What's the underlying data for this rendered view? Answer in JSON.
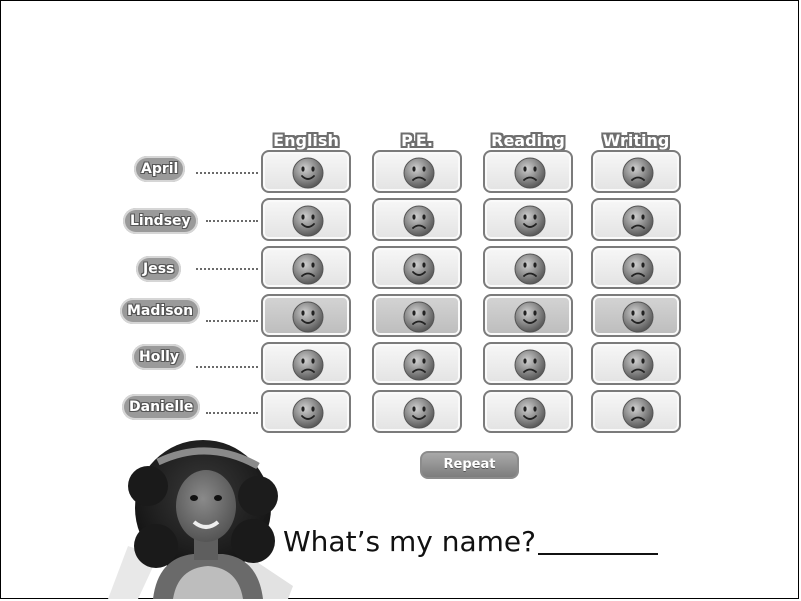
{
  "columns": [
    "English",
    "P.E.",
    "Reading",
    "Writing"
  ],
  "rows": [
    {
      "name": "April",
      "faces": [
        "happy",
        "sad",
        "sad",
        "sad"
      ]
    },
    {
      "name": "Lindsey",
      "faces": [
        "happy",
        "sad",
        "happy",
        "sad"
      ]
    },
    {
      "name": "Jess",
      "faces": [
        "sad",
        "happy",
        "sad",
        "sad"
      ]
    },
    {
      "name": "Madison",
      "faces": [
        "happy",
        "sad",
        "happy",
        "happy"
      ]
    },
    {
      "name": "Holly",
      "faces": [
        "sad",
        "sad",
        "sad",
        "sad"
      ]
    },
    {
      "name": "Danielle",
      "faces": [
        "happy",
        "happy",
        "happy",
        "sad"
      ]
    }
  ],
  "highlighted_row": "Madison",
  "repeat_label": "Repeat",
  "question": "What’s my name?",
  "icons": {
    "face_happy": "happy-face-icon",
    "face_sad": "sad-face-icon"
  },
  "colors": {
    "cell_border": "#7b7b7b",
    "pill": "#9a9a9a"
  }
}
